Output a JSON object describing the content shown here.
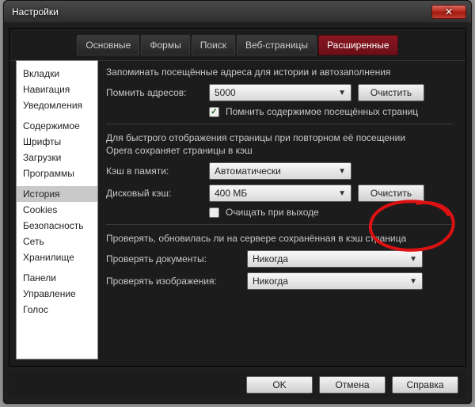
{
  "window": {
    "title": "Настройки"
  },
  "tabs": [
    {
      "label": "Основные"
    },
    {
      "label": "Формы"
    },
    {
      "label": "Поиск"
    },
    {
      "label": "Веб-страницы"
    },
    {
      "label": "Расширенные",
      "active": true
    }
  ],
  "sidebar": {
    "groups": [
      [
        "Вкладки",
        "Навигация",
        "Уведомления"
      ],
      [
        "Содержимое",
        "Шрифты",
        "Загрузки",
        "Программы"
      ],
      [
        "История",
        "Cookies",
        "Безопасность",
        "Сеть",
        "Хранилище"
      ],
      [
        "Панели",
        "Управление",
        "Голос"
      ]
    ],
    "selected": "История"
  },
  "history": {
    "heading1": "Запоминать посещённые адреса для истории и автозаполнения",
    "remember_label": "Помнить адресов:",
    "remember_value": "5000",
    "clear1_label": "Очистить",
    "remember_content_checked": true,
    "remember_content_label": "Помнить содержимое посещённых страниц",
    "heading2a": "Для быстрого отображения страницы при повторном её посещении",
    "heading2b": "Opera сохраняет страницы в кэш",
    "mem_cache_label": "Кэш в памяти:",
    "mem_cache_value": "Автоматически",
    "disk_cache_label": "Дисковый кэш:",
    "disk_cache_value": "400 МБ",
    "clear2_label": "Очистить",
    "clear_on_exit_checked": false,
    "clear_on_exit_label": "Очищать при выходе",
    "heading3": "Проверять, обновилась ли на сервере сохранённая в кэш страница",
    "check_docs_label": "Проверять документы:",
    "check_docs_value": "Никогда",
    "check_imgs_label": "Проверять изображения:",
    "check_imgs_value": "Никогда"
  },
  "footer": {
    "ok": "OK",
    "cancel": "Отмена",
    "help": "Справка"
  }
}
